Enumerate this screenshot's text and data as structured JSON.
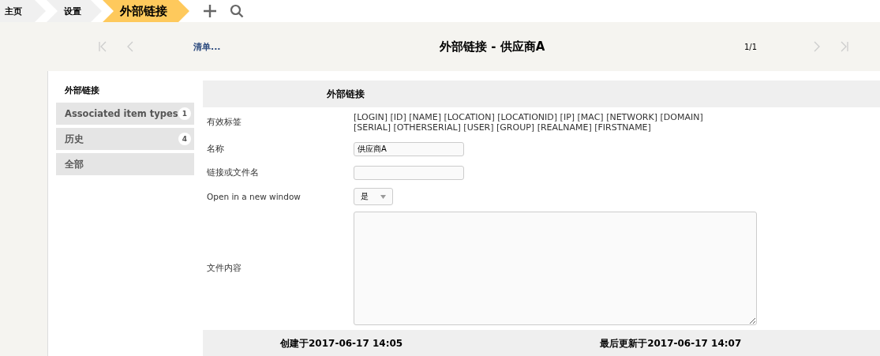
{
  "breadcrumbs": [
    {
      "label": "主页",
      "selected": false
    },
    {
      "label": "设置",
      "selected": false
    },
    {
      "label": "外部链接",
      "selected": true
    }
  ],
  "nav": {
    "list_link": "清单...",
    "title": "外部链接 - 供应商A",
    "counter": "1/1"
  },
  "tabs": [
    {
      "label": "外部链接",
      "selected": true
    },
    {
      "label": "Associated item types",
      "count": "1",
      "selected": false
    },
    {
      "label": "历史",
      "count": "4",
      "selected": false
    },
    {
      "label": "全部",
      "selected": false
    }
  ],
  "form": {
    "heading": "外部链接",
    "fields": [
      {
        "kind": "text",
        "label": "有效标签",
        "value": "[LOGIN] [ID] [NAME] [LOCATION] [LOCATIONID] [IP] [MAC] [NETWORK] [DOMAIN] [SERIAL] [OTHERSERIAL] [USER] [GROUP] [REALNAME] [FIRSTNAME]"
      },
      {
        "kind": "input",
        "label": "名称",
        "value": "供应商A"
      },
      {
        "kind": "input",
        "label": "链接或文件名"
      },
      {
        "kind": "select",
        "label": "Open in a new window",
        "value": "是"
      },
      {
        "kind": "textarea",
        "label": "文件内容"
      }
    ],
    "footer": [
      "创建于2017-06-17 14:05",
      "最后更新于2017-06-17 14:07"
    ]
  }
}
